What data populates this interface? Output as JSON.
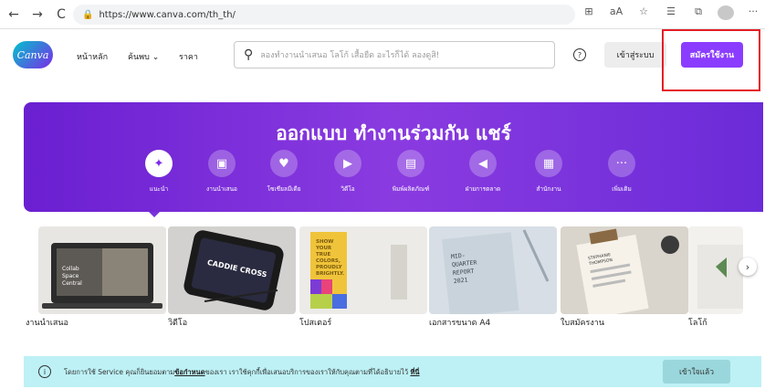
{
  "browser": {
    "url": "https://www.canva.com/th_th/",
    "back_icon": "←",
    "forward_icon": "→",
    "reload_icon": "C",
    "more_icon": "···"
  },
  "nav": {
    "logo_text": "Canva",
    "home": "หน้าหลัก",
    "discover": "ค้นพบ",
    "pricing": "ราคา",
    "search_placeholder": "ลองทำงานนำเสนอ โลโก้ เสื้อยืด อะไรก็ได้ ลองดูสิ!",
    "help_icon": "?",
    "login": "เข้าสู่ระบบ",
    "signup": "สมัครใช้งาน"
  },
  "hero": {
    "title": "ออกแบบ ทำงานร่วมกัน แชร์",
    "categories": [
      {
        "label": "แนะนำ",
        "icon": "✦"
      },
      {
        "label": "งานนำเสนอ",
        "icon": "▣"
      },
      {
        "label": "โซเชียลมีเดีย",
        "icon": "♥"
      },
      {
        "label": "วิดีโอ",
        "icon": "▶"
      },
      {
        "label": "พิมพ์ผลิตภัณฑ์",
        "icon": "▤"
      },
      {
        "label": "ฝ่ายการตลาด",
        "icon": "◀"
      },
      {
        "label": "สำนักงาน",
        "icon": "▦"
      },
      {
        "label": "เพิ่มเติม",
        "icon": "···"
      }
    ]
  },
  "gallery": [
    {
      "label": "งานนำเสนอ",
      "image_text": "Collab Space Central"
    },
    {
      "label": "วิดีโอ",
      "image_text": "CADDIE CROSS"
    },
    {
      "label": "โปสเตอร์",
      "image_text": "SHOW YOUR TRUE COLORS, PROUDLY, BRIGHTLY."
    },
    {
      "label": "เอกสารขนาด A4",
      "image_text": "MID-QUARTER REPORT 2021"
    },
    {
      "label": "ใบสมัครงาน",
      "image_text": "STEPHANIE THOMPSON"
    },
    {
      "label": "โลโก้",
      "image_text": ""
    }
  ],
  "cookie": {
    "text_before": "โดยการใช้ Service คุณก็ยินยอมตาม",
    "terms_link": "ข้อกำหนด",
    "text_middle": "ของเรา เราใช้คุกกี้เพื่อเสนอบริการของเราให้กับคุณตามที่ได้อธิบายไว้ ",
    "here_link": "ที่นี่",
    "accept": "เข้าใจแล้ว"
  },
  "colors": {
    "brand_purple": "#8b3dff",
    "hero_purple": "#7a32dc",
    "cookie_bg": "#bdf1f5",
    "highlight_red": "#e41e26"
  }
}
